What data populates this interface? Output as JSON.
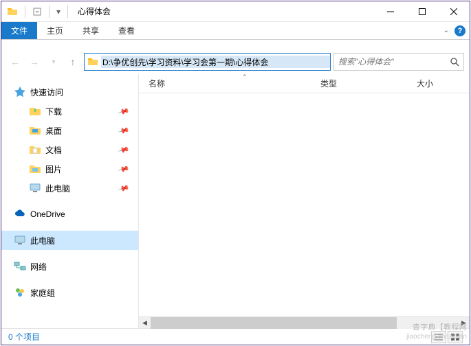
{
  "window": {
    "title": "心得体会"
  },
  "ribbon": {
    "file": "文件",
    "tabs": [
      "主页",
      "共享",
      "查看"
    ]
  },
  "nav": {
    "path": "D:\\争优创先\\学习资料\\学习会第一期\\心得体会",
    "search_placeholder": "搜索\"心得体会\""
  },
  "sidebar": {
    "quick_access": "快速访问",
    "items": [
      "下载",
      "桌面",
      "文档",
      "图片",
      "此电脑"
    ],
    "onedrive": "OneDrive",
    "this_pc": "此电脑",
    "network": "网络",
    "homegroup": "家庭组"
  },
  "columns": {
    "name": "名称",
    "type": "类型",
    "size": "大小"
  },
  "status": {
    "count": "0 个项目"
  },
  "watermark": {
    "line1": "查字典【教程网",
    "line2": "jiaocheng.chazidian"
  }
}
